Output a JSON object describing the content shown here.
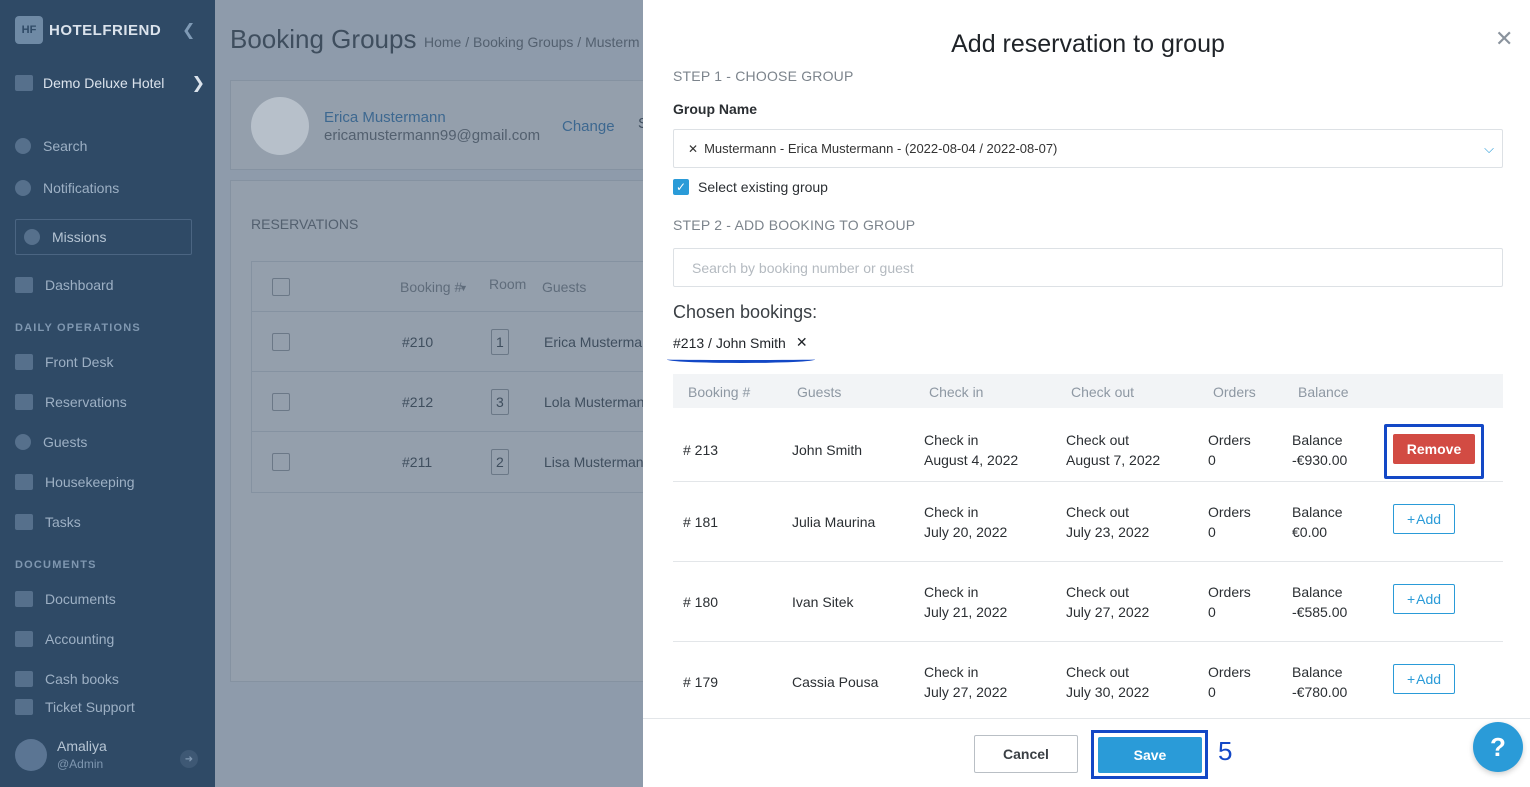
{
  "brand": {
    "name": "HOTELFRIEND",
    "logo_text": "HF"
  },
  "sidebar": {
    "hotel": "Demo Deluxe Hotel",
    "search": "Search",
    "notifications": "Notifications",
    "missions": "Missions",
    "dashboard": "Dashboard",
    "section_daily": "DAILY OPERATIONS",
    "front_desk": "Front Desk",
    "reservations": "Reservations",
    "guests": "Guests",
    "housekeeping": "Housekeeping",
    "tasks": "Tasks",
    "section_documents": "DOCUMENTS",
    "documents": "Documents",
    "accounting": "Accounting",
    "cash_books": "Cash books",
    "ticket_support": "Ticket Support",
    "user_name": "Amaliya",
    "user_role": "@Admin"
  },
  "main": {
    "title": "Booking Groups",
    "breadcrumb": "Home / Booking Groups / Musterm",
    "profile_name": "Erica Mustermann",
    "profile_email": "ericamustermann99@gmail.com",
    "change": "Change",
    "s_partial": "S",
    "reservations_title": "RESERVATIONS",
    "table_headers": {
      "booking": "Booking #",
      "room": "Room",
      "guests": "Guests"
    },
    "rows": [
      {
        "booking": "#210",
        "room": "1",
        "guest": "Erica Musterma"
      },
      {
        "booking": "#212",
        "room": "3",
        "guest": "Lola Musterman"
      },
      {
        "booking": "#211",
        "room": "2",
        "guest": "Lisa Musterman"
      }
    ]
  },
  "modal": {
    "title": "Add reservation to group",
    "step1": "STEP 1 - CHOOSE GROUP",
    "group_name_label": "Group Name",
    "group_selected": "Mustermann - Erica Mustermann - (2022-08-04 / 2022-08-07)",
    "select_existing": "Select existing group",
    "step2": "STEP 2 - ADD BOOKING TO GROUP",
    "search_placeholder": "Search by booking number or guest",
    "chosen_label": "Chosen bookings:",
    "chosen_chip": "#213 / John Smith",
    "table_headers": {
      "booking": "Booking #",
      "guests": "Guests",
      "check_in": "Check in",
      "check_out": "Check out",
      "orders": "Orders",
      "balance": "Balance"
    },
    "row_labels": {
      "check_in": "Check in",
      "check_out": "Check out",
      "orders": "Orders",
      "balance": "Balance"
    },
    "bookings": [
      {
        "number": "# 213",
        "guest": "John Smith",
        "check_in": "August 4, 2022",
        "check_out": "August 7, 2022",
        "orders": "0",
        "balance": "-€930.00",
        "action": "Remove"
      },
      {
        "number": "# 181",
        "guest": "Julia Maurina",
        "check_in": "July 20, 2022",
        "check_out": "July 23, 2022",
        "orders": "0",
        "balance": "€0.00",
        "action": "Add"
      },
      {
        "number": "# 180",
        "guest": "Ivan Sitek",
        "check_in": "July 21, 2022",
        "check_out": "July 27, 2022",
        "orders": "0",
        "balance": "-€585.00",
        "action": "Add"
      },
      {
        "number": "# 179",
        "guest": "Cassia Pousa",
        "check_in": "July 27, 2022",
        "check_out": "July 30, 2022",
        "orders": "0",
        "balance": "-€780.00",
        "action": "Add"
      }
    ],
    "cancel": "Cancel",
    "save": "Save",
    "step_number": "5"
  },
  "help": "?",
  "colors": {
    "accent": "#2a9bd8",
    "remove": "#d24b43",
    "highlight": "#1348c6"
  }
}
